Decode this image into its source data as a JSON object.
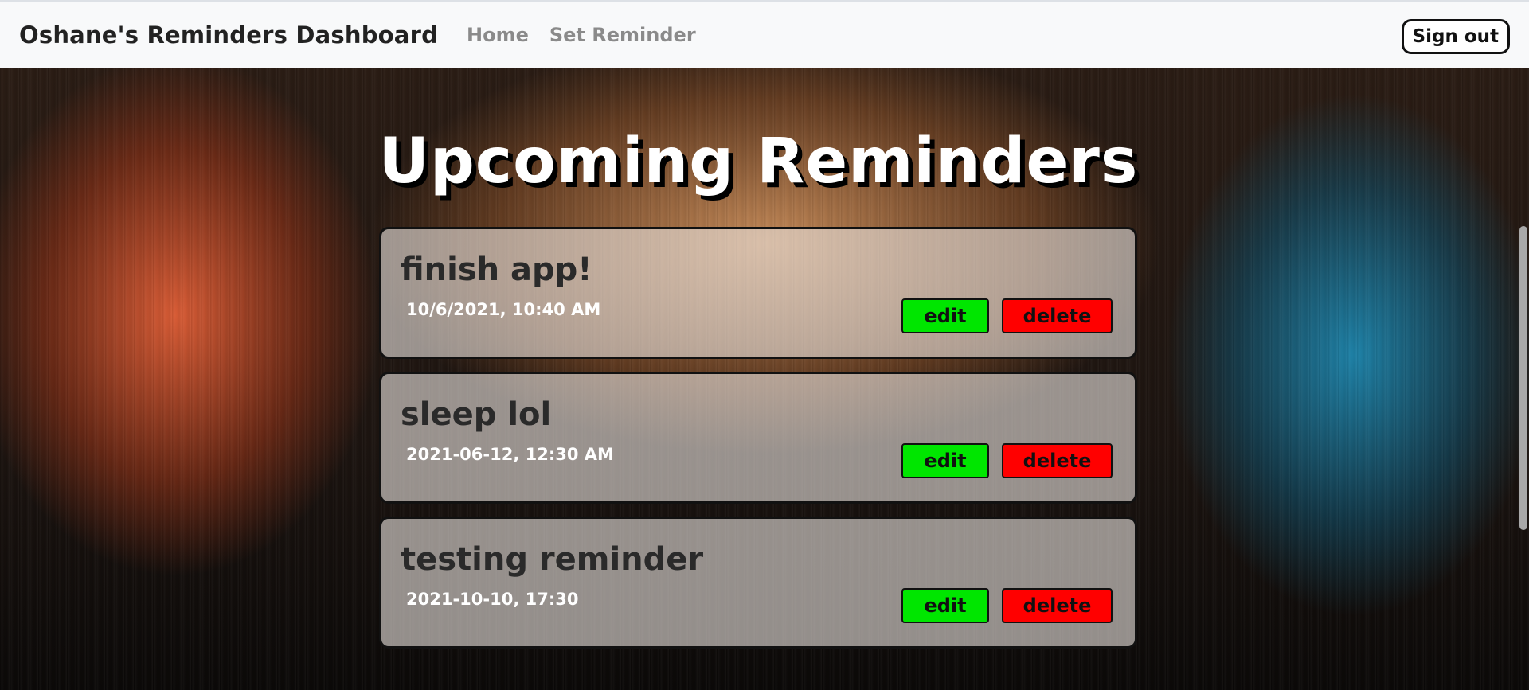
{
  "navbar": {
    "brand": "Oshane's Reminders Dashboard",
    "links": [
      "Home",
      "Set Reminder"
    ],
    "signout_label": "Sign out"
  },
  "main": {
    "title": "Upcoming Reminders",
    "reminders": [
      {
        "title": "finish app!",
        "date": "10/6/2021, 10:40 AM",
        "edit_label": "edit",
        "delete_label": "delete"
      },
      {
        "title": "sleep lol",
        "date": "2021-06-12, 12:30 AM",
        "edit_label": "edit",
        "delete_label": "delete"
      },
      {
        "title": "testing reminder",
        "date": "2021-10-10, 17:30",
        "edit_label": "edit",
        "delete_label": "delete"
      }
    ]
  },
  "colors": {
    "navbar_bg": "#f8f9fa",
    "edit_button": "#00e600",
    "delete_button": "#ff0000",
    "title_text": "#ffffff"
  }
}
